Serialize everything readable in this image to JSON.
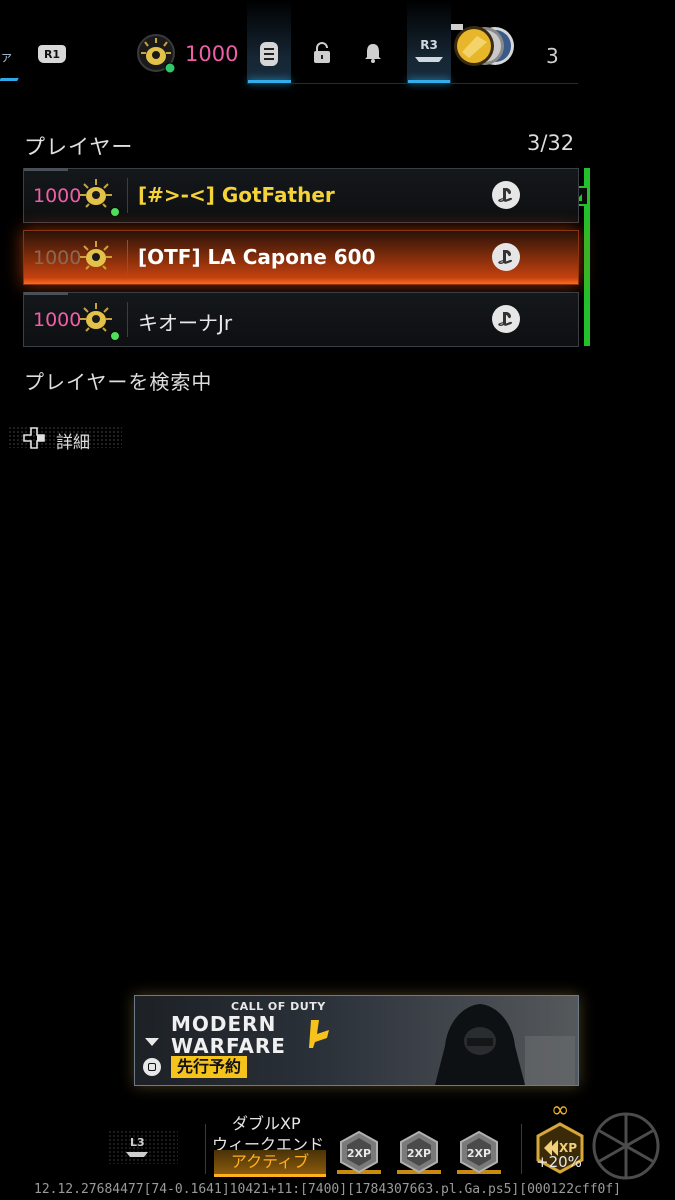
{
  "top_bar": {
    "left_tab_fragment": "ァ",
    "r1_label": "R1",
    "currency_value": "1000",
    "r3_label": "R3",
    "party_count": "3"
  },
  "players": {
    "title": "プレイヤー",
    "count": "3/32",
    "rows": [
      {
        "cp": "1000",
        "name": "[#>-<] GotFather",
        "name_color": "#f3d23a",
        "highlighted": false
      },
      {
        "cp": "1000",
        "name": "[OTF] LA Capone 600",
        "name_color": "#ffffff",
        "highlighted": true
      },
      {
        "cp": "1000",
        "name": "キオーナJr",
        "name_color": "#e8e8e8",
        "highlighted": false
      }
    ],
    "searching": "プレイヤーを検索中",
    "details_label": "詳細"
  },
  "banner": {
    "brand_small": "CALL OF DUTY",
    "brand_line1": "MODERN",
    "brand_line2": "WARFARE",
    "preorder": "先行予約"
  },
  "bottom_bar": {
    "l3_label": "L3",
    "double_xp_line1": "ダブルXP",
    "double_xp_line2": "ウィークエンド",
    "double_xp_status": "アクティブ",
    "token_label": "2XP",
    "xp_infinity": "∞",
    "xp_boost": "+20%"
  },
  "footer": {
    "session_id": "12.12.27684477[74-0.1641]10421+11:[7400][1784307663.pl.Ga.ps5][000122cff0f]"
  },
  "colors": {
    "accent_blue": "#33aee8",
    "cp_pink": "#ee5fa8",
    "leader_green": "#22c02a",
    "highlight_orange": "#ff6a1a",
    "preorder_yellow": "#f5c31b",
    "active_amber": "#ffb020"
  },
  "icons": [
    "menu-icon",
    "lock-icon",
    "bell-icon",
    "playstation-icon",
    "crown-icon",
    "dpad-icon",
    "calling-card-icon",
    "xp-token-icon",
    "watermark-logo"
  ]
}
